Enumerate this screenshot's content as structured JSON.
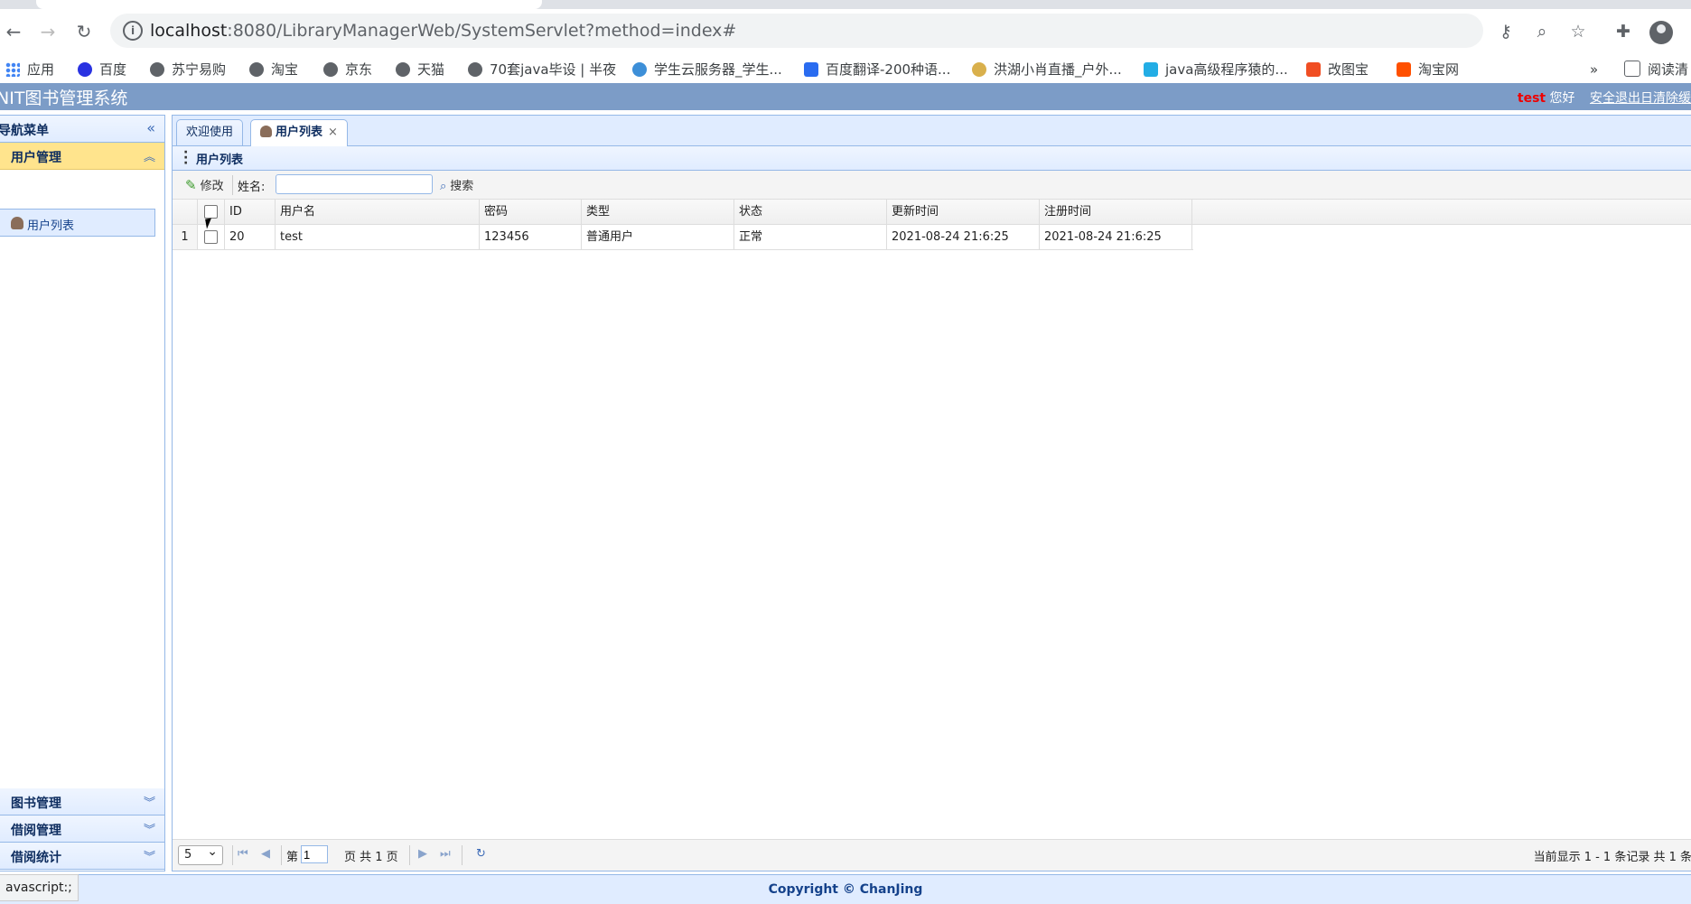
{
  "browser": {
    "url_host": "localhost",
    "url_rest": ":8080/LibraryManagerWeb/SystemServlet?method=index#",
    "bookmarks": [
      "应用",
      "百度",
      "苏宁易购",
      "淘宝",
      "京东",
      "天猫",
      "70套java毕设 | 半夜",
      "学生云服务器_学生...",
      "百度翻译-200种语...",
      "洪湖小肖直播_户外...",
      "java高级程序猿的...",
      "改图宝",
      "淘宝网"
    ],
    "more": "»",
    "reading_list": "阅读清",
    "status_text": "avascript:;"
  },
  "app": {
    "title": "NIT图书管理系统",
    "user": "test",
    "greeting": "您好",
    "logout": "安全退出日清除缓",
    "footer": "Copyright © ChanJing"
  },
  "sidebar": {
    "title": "导航菜单",
    "sections": [
      {
        "label": "用户管理",
        "items": [
          "用户列表"
        ]
      },
      {
        "label": "图书管理"
      },
      {
        "label": "借阅管理"
      },
      {
        "label": "借阅统计"
      }
    ]
  },
  "tabs": [
    {
      "label": "欢迎使用"
    },
    {
      "label": "用户列表",
      "close": "×"
    }
  ],
  "panel": {
    "title": "用户列表",
    "toolbar": {
      "edit": "修改",
      "name_label": "姓名:",
      "name_value": "",
      "search": "搜索"
    }
  },
  "grid": {
    "columns": [
      "ID",
      "用户名",
      "密码",
      "类型",
      "状态",
      "更新时间",
      "注册时间"
    ],
    "rows": [
      {
        "num": "1",
        "id": "20",
        "username": "test",
        "password": "123456",
        "type": "普通用户",
        "status": "正常",
        "updated": "2021-08-24 21:6:25",
        "registered": "2021-08-24 21:6:25"
      }
    ]
  },
  "pager": {
    "page_size": "5",
    "page_prefix": "第",
    "page_value": "1",
    "page_suffix": "页 共 1 页",
    "info": "当前显示 1 - 1 条记录 共 1 条"
  }
}
